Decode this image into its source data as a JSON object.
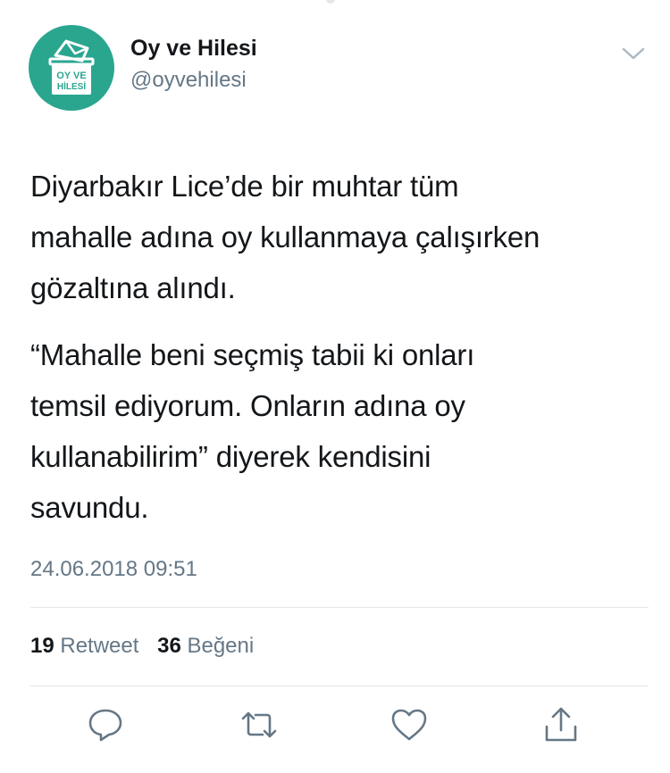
{
  "author": {
    "name": "Oy ve Hilesi",
    "handle": "@oyvehilesi",
    "avatar_text_line1": "OY VE",
    "avatar_text_line2": "HİLESİ",
    "avatar_color": "#2aa68f"
  },
  "tweet": {
    "paragraph1": "Diyarbakır Lice’de bir muhtar tüm\nmahalle adına oy kullanmaya çalışırken\ngözaltına alındı.",
    "paragraph2": "“Mahalle beni seçmiş tabii ki onları\ntemsil ediyorum. Onların adına oy\nkullanabilirim” diyerek kendisini\nsavundu.",
    "timestamp": "24.06.2018 09:51"
  },
  "stats": {
    "retweet_count": "19",
    "retweet_label": "Retweet",
    "like_count": "36",
    "like_label": "Beğeni"
  },
  "actions": {
    "reply_icon": "reply-icon",
    "retweet_icon": "retweet-icon",
    "like_icon": "heart-icon",
    "share_icon": "share-icon"
  },
  "colors": {
    "text": "#14171a",
    "secondary": "#657786",
    "divider": "#e1e8ed"
  }
}
